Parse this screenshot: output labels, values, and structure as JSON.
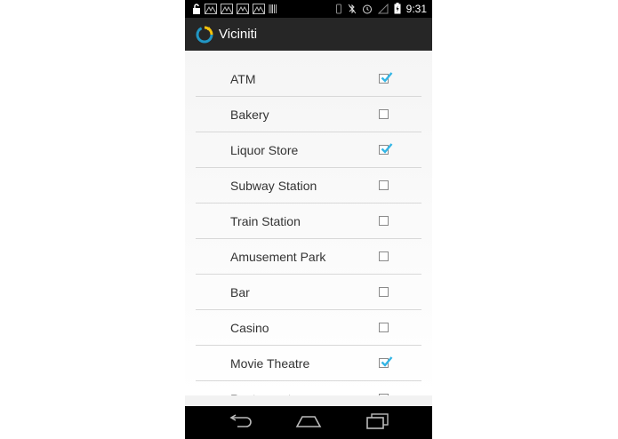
{
  "status_bar": {
    "time": "9:31",
    "left_icons": [
      "unlock-icon",
      "gallery-icon",
      "gallery-icon",
      "gallery-icon",
      "gallery-icon",
      "barcode-icon"
    ],
    "right_icons": [
      "vibrate-icon",
      "bluetooth-off-icon",
      "alarm-icon",
      "signal-icon",
      "battery-icon"
    ]
  },
  "action_bar": {
    "title": "Viciniti",
    "logo_colors": {
      "ring": "#2196c4",
      "arrow": "#f4c20d"
    }
  },
  "list": {
    "accent_color": "#33b5e5",
    "items": [
      {
        "label": "ATM",
        "checked": true
      },
      {
        "label": "Bakery",
        "checked": false
      },
      {
        "label": "Liquor Store",
        "checked": true
      },
      {
        "label": "Subway Station",
        "checked": false
      },
      {
        "label": "Train Station",
        "checked": false
      },
      {
        "label": "Amusement Park",
        "checked": false
      },
      {
        "label": "Bar",
        "checked": false
      },
      {
        "label": "Casino",
        "checked": false
      },
      {
        "label": "Movie Theatre",
        "checked": true
      },
      {
        "label": "Restaurant",
        "checked": false
      }
    ]
  },
  "nav_bar": {
    "buttons": [
      "back-icon",
      "home-icon",
      "recents-icon"
    ]
  }
}
